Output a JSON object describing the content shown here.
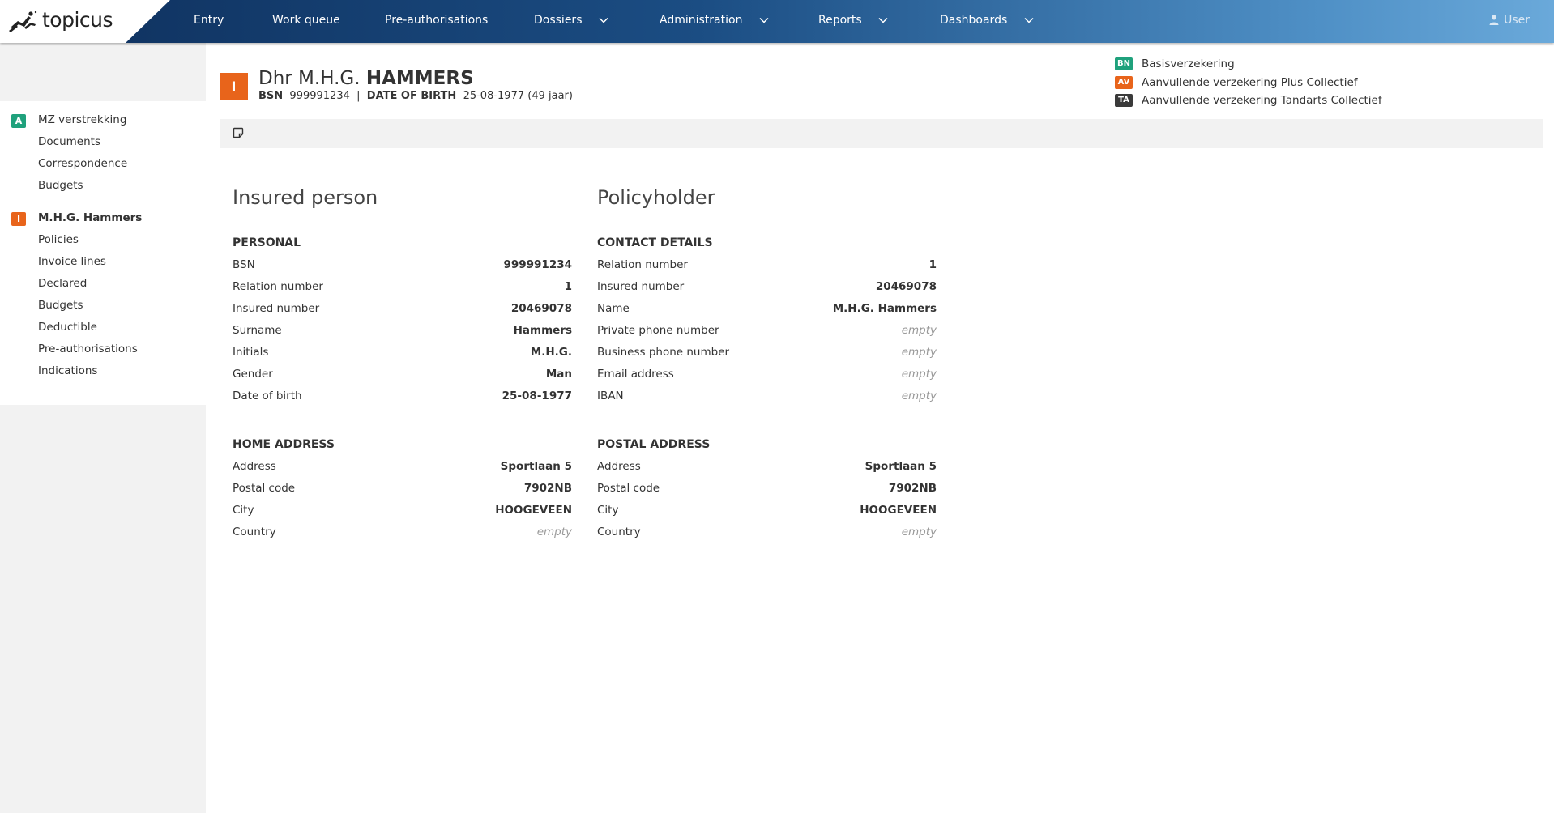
{
  "app": {
    "logo_text": "topicus"
  },
  "nav": {
    "items": [
      {
        "label": "Entry"
      },
      {
        "label": "Work queue"
      },
      {
        "label": "Pre-authorisations"
      },
      {
        "label": "Dossiers"
      },
      {
        "label": "Administration"
      },
      {
        "label": "Reports"
      },
      {
        "label": "Dashboards"
      }
    ],
    "user_label": "User"
  },
  "sidebar": {
    "group1": {
      "badge": "A",
      "title": "MZ verstrekking",
      "items": [
        "Documents",
        "Correspondence",
        "Budgets"
      ]
    },
    "group2": {
      "badge": "I",
      "title": "M.H.G. Hammers",
      "items": [
        "Policies",
        "Invoice lines",
        "Declared",
        "Budgets",
        "Deductible",
        "Pre-authorisations",
        "Indications"
      ]
    }
  },
  "header": {
    "badge": "I",
    "salutation": "Dhr M.H.G.",
    "surname": "HAMMERS",
    "bsn_label": "BSN",
    "bsn": "999991234",
    "separator": "|",
    "dob_label": "DATE OF BIRTH",
    "dob": "25-08-1977 (49 jaar)",
    "policies": [
      {
        "code": "BN",
        "name": "Basisverzekering",
        "color": "#1fa17c"
      },
      {
        "code": "AV",
        "name": "Aanvullende verzekering Plus Collectief",
        "color": "#e8641b"
      },
      {
        "code": "TA",
        "name": "Aanvullende verzekering Tandarts Collectief",
        "color": "#3a3a3a"
      }
    ]
  },
  "insured": {
    "title": "Insured person",
    "personal_title": "PERSONAL",
    "personal": [
      {
        "label": "BSN",
        "value": "999991234"
      },
      {
        "label": "Relation number",
        "value": "1"
      },
      {
        "label": "Insured number",
        "value": "20469078"
      },
      {
        "label": "Surname",
        "value": "Hammers"
      },
      {
        "label": "Initials",
        "value": "M.H.G."
      },
      {
        "label": "Gender",
        "value": "Man"
      },
      {
        "label": "Date of birth",
        "value": "25-08-1977"
      }
    ],
    "address_title": "HOME ADDRESS",
    "address": [
      {
        "label": "Address",
        "value": "Sportlaan 5"
      },
      {
        "label": "Postal code",
        "value": "7902NB"
      },
      {
        "label": "City",
        "value": "HOOGEVEEN"
      },
      {
        "label": "Country",
        "value": "empty",
        "empty": true
      }
    ]
  },
  "policyholder": {
    "title": "Policyholder",
    "contact_title": "CONTACT DETAILS",
    "contact": [
      {
        "label": "Relation number",
        "value": "1"
      },
      {
        "label": "Insured number",
        "value": "20469078"
      },
      {
        "label": "Name",
        "value": "M.H.G. Hammers"
      },
      {
        "label": "Private phone number",
        "value": "empty",
        "empty": true
      },
      {
        "label": "Business phone number",
        "value": "empty",
        "empty": true
      },
      {
        "label": "Email address",
        "value": "empty",
        "empty": true
      },
      {
        "label": "IBAN",
        "value": "empty",
        "empty": true
      }
    ],
    "address_title": "POSTAL ADDRESS",
    "address": [
      {
        "label": "Address",
        "value": "Sportlaan 5"
      },
      {
        "label": "Postal code",
        "value": "7902NB"
      },
      {
        "label": "City",
        "value": "HOOGEVEEN"
      },
      {
        "label": "Country",
        "value": "empty",
        "empty": true
      }
    ]
  }
}
